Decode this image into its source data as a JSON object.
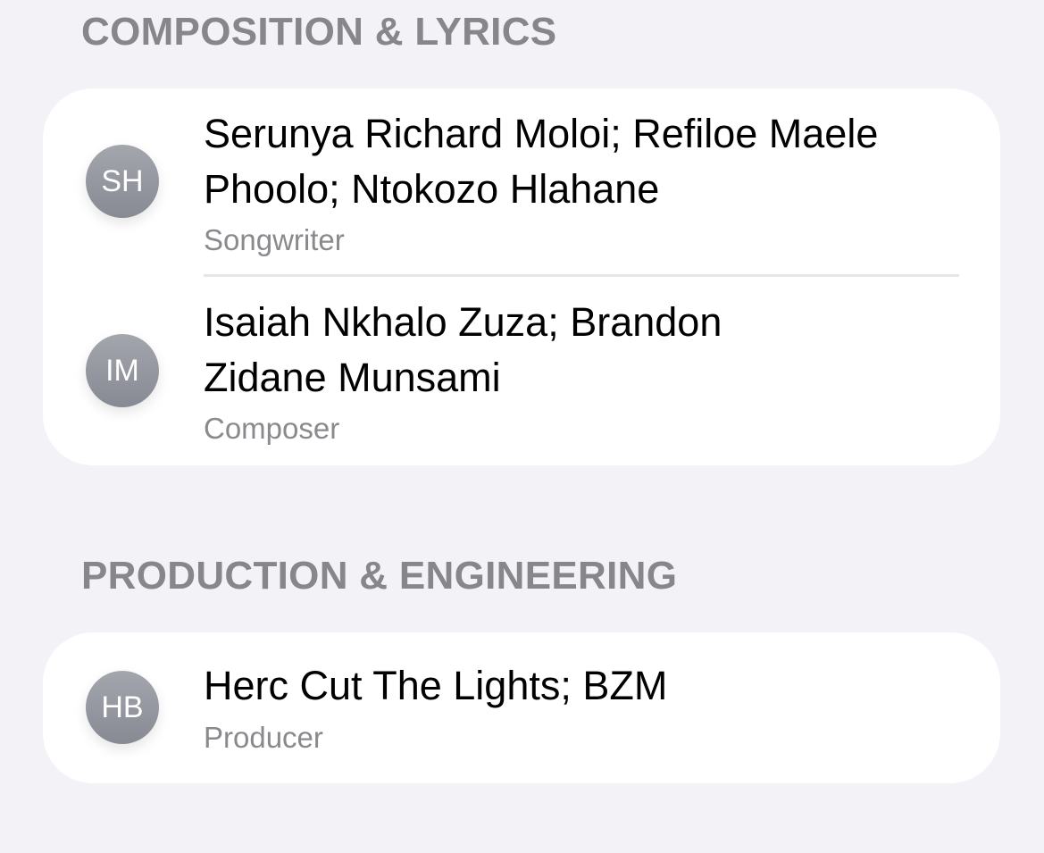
{
  "sections": [
    {
      "header": "COMPOSITION & LYRICS",
      "rows": [
        {
          "initials": "SH",
          "name_line1": "Serunya Richard Moloi; Refiloe Maele",
          "name_line2": "Phoolo; Ntokozo Hlahane",
          "role": "Songwriter"
        },
        {
          "initials": "IM",
          "name_line1": "Isaiah Nkhalo Zuza; Brandon",
          "name_line2": "Zidane Munsami",
          "role": "Composer"
        }
      ]
    },
    {
      "header": "PRODUCTION & ENGINEERING",
      "rows": [
        {
          "initials": "HB",
          "name_line1": "Herc Cut The Lights; BZM",
          "role": "Producer"
        }
      ]
    }
  ]
}
